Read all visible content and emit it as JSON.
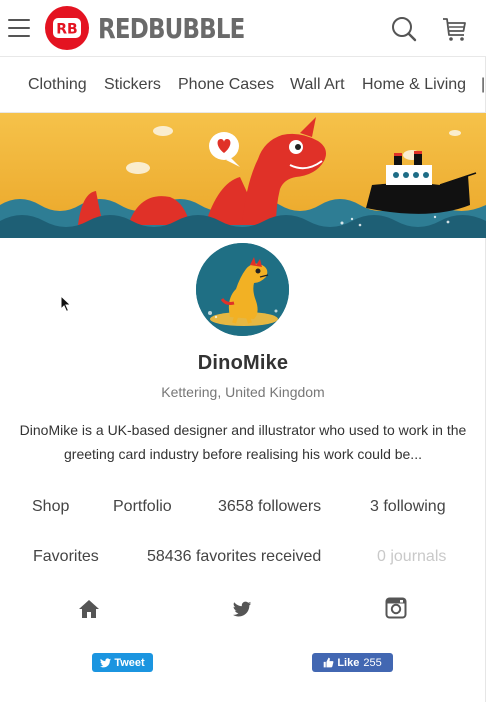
{
  "header": {
    "brand": "REDBUBBLE",
    "menu_icon": "hamburger-menu-icon",
    "search_icon": "search-icon",
    "cart_icon": "shopping-cart-icon"
  },
  "nav": {
    "items": [
      "Clothing",
      "Stickers",
      "Phone Cases",
      "Wall Art",
      "Home & Living"
    ]
  },
  "profile": {
    "name": "DinoMike",
    "location": "Kettering, United Kingdom",
    "bio": "DinoMike is a UK-based designer and illustrator who used to work in the greeting card industry before realising his work could be..."
  },
  "stats": {
    "shop": "Shop",
    "portfolio": "Portfolio",
    "followers": "3658 followers",
    "following": "3 following",
    "favorites": "Favorites",
    "favorites_received": "58436 favorites received",
    "journals": "0 journals"
  },
  "social": {
    "home_icon": "home-icon",
    "twitter_icon": "twitter-icon",
    "instagram_icon": "instagram-icon"
  },
  "share": {
    "tweet_label": "Tweet",
    "like_label": "Like",
    "like_count": "255"
  },
  "colors": {
    "brand_red": "#e41321",
    "twitter_blue": "#1b95e0",
    "facebook_blue": "#4267b2",
    "banner_sky": "#f2b232",
    "sea": "#1e6d86"
  }
}
